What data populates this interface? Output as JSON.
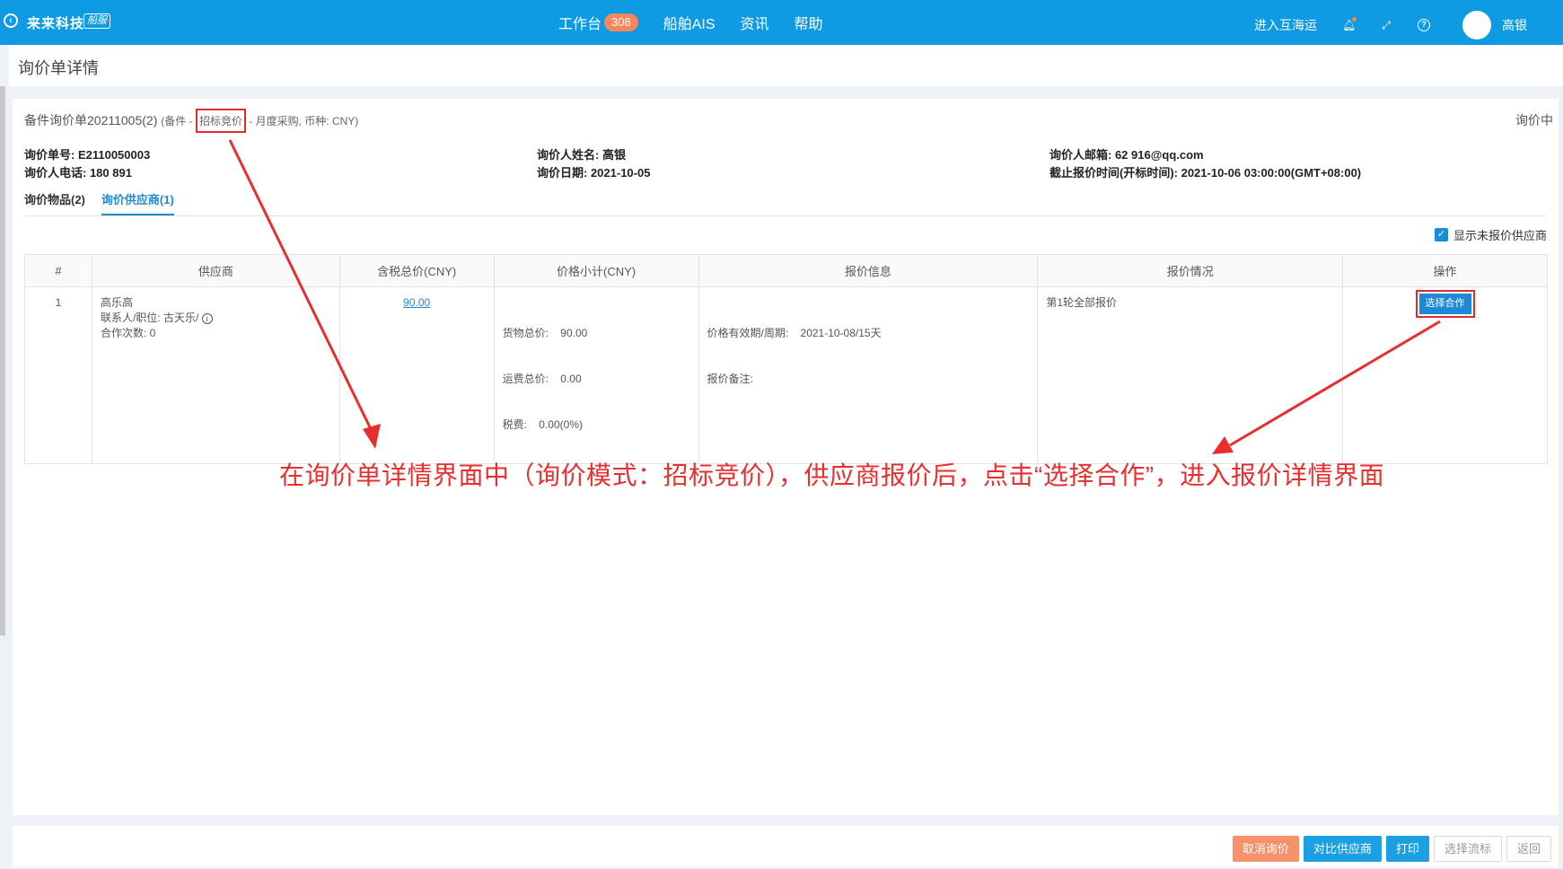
{
  "header": {
    "brand": "来来科技",
    "brand_tag": "船服",
    "nav": [
      {
        "label": "工作台",
        "badge": "308"
      },
      {
        "label": "船舶AIS"
      },
      {
        "label": "资讯"
      },
      {
        "label": "帮助"
      }
    ],
    "enter_link": "进入互海运",
    "user_name": "高银"
  },
  "page_title": "询价单详情",
  "inquiry": {
    "name": "备件询价单20211005(2)",
    "meta_prefix": "(备件 - ",
    "mode": "招标竞价",
    "meta_suffix": " - 月度采购, 币种: CNY)",
    "status": "询价中",
    "number": "询价单号: E2110050003",
    "phone": "询价人电话: 180        891",
    "inquirer": "询价人姓名: 高银",
    "date": "询价日期: 2021-10-05",
    "email": "询价人邮箱: 62        916@qq.com",
    "deadline": "截止报价时间(开标时间): 2021-10-06 03:00:00(GMT+08:00)"
  },
  "tabs": [
    "询价物品(2)",
    "询价供应商(1)"
  ],
  "show_unquoted_label": "显示未报价供应商",
  "table": {
    "headers": [
      "#",
      "供应商",
      "含税总价(CNY)",
      "价格小计(CNY)",
      "报价信息",
      "报价情况",
      "操作"
    ],
    "rows": [
      {
        "index": "1",
        "supplier": "高乐高",
        "contact": "联系人/职位: 古天乐/",
        "coop": "合作次数: 0",
        "total": "90.00",
        "goods": "货物总价:    90.00",
        "freight": "运费总价:    0.00",
        "tax": "税费:    0.00(0%)",
        "validity": "价格有效期/周期:    2021-10-08/15天",
        "remark": "报价备注:",
        "quote_status": "第1轮全部报价",
        "action": "选择合作"
      }
    ]
  },
  "annotation": "在询价单详情界面中（询价模式：招标竞价），供应商报价后，点击“选择合作”，进入报价详情界面",
  "footer_buttons": [
    "取消询价",
    "对比供应商",
    "打印",
    "选择流标",
    "返回"
  ],
  "colors": {
    "topbar": "#0e9be4",
    "accent": "#1d8ad8",
    "annotation": "#ea2e2e",
    "cancel": "#f5916b"
  }
}
